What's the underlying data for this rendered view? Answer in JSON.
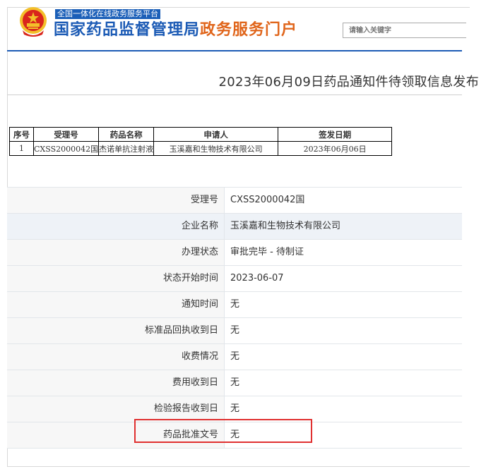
{
  "header": {
    "platform_tag": "全国一体化在线政务服务平台",
    "site_name_main": "国家药品监督管理局",
    "site_name_accent": "政务服务门户",
    "search_placeholder": "请输入关键字"
  },
  "page_title": "2023年06月09日药品通知件待领取信息发布",
  "notice_table": {
    "headers": [
      "序号",
      "受理号",
      "药品名称",
      "申请人",
      "签发日期"
    ],
    "rows": [
      [
        "1",
        "CXSS2000042国",
        "杰诺单抗注射液",
        "玉溪嘉和生物技术有限公司",
        "2023年06月06日"
      ]
    ]
  },
  "detail": [
    {
      "label": "受理号",
      "value": "CXSS2000042国"
    },
    {
      "label": "企业名称",
      "value": "玉溪嘉和生物技术有限公司"
    },
    {
      "label": "办理状态",
      "value": "审批完毕 - 待制证"
    },
    {
      "label": "状态开始时间",
      "value": "2023-06-07"
    },
    {
      "label": "通知时间",
      "value": "无"
    },
    {
      "label": "标准品回执收到日",
      "value": "无"
    },
    {
      "label": "收费情况",
      "value": "无"
    },
    {
      "label": "费用收到日",
      "value": "无"
    },
    {
      "label": "检验报告收到日",
      "value": "无"
    },
    {
      "label": "药品批准文号",
      "value": "无"
    }
  ],
  "colors": {
    "brand_blue": "#1c5bb5",
    "brand_orange": "#e0651b",
    "highlight_red": "#e03030",
    "emblem_red": "#d9261c",
    "emblem_gold": "#f3c02a"
  },
  "icons": {
    "emblem": "national-emblem-icon"
  }
}
